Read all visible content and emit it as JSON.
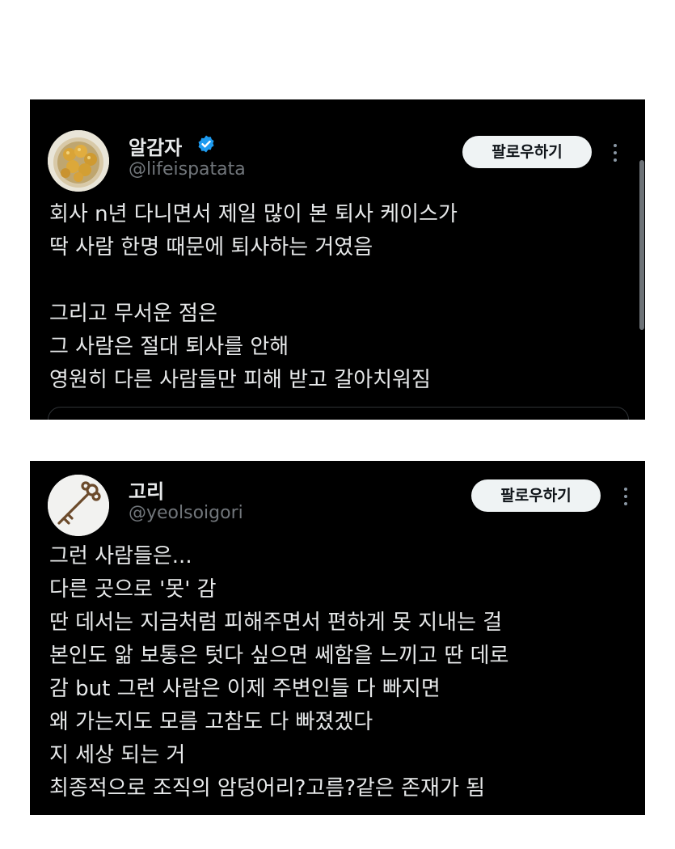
{
  "tweets": [
    {
      "name": "알감자",
      "handle": "@lifeispatata",
      "verified": true,
      "follow_label": "팔로우하기",
      "lines": [
        "회사 n년 다니면서 제일 많이 본 퇴사 케이스가",
        "딱 사람 한명 때문에 퇴사하는 거였음",
        "",
        "그리고 무서운 점은",
        "그 사람은 절대 퇴사를 안해",
        "영원히 다른 사람들만 피해 받고 갈아치워짐"
      ]
    },
    {
      "name": "고리",
      "handle": "@yeolsoigori",
      "verified": false,
      "follow_label": "팔로우하기",
      "lines": [
        "그런 사람들은...",
        "다른 곳으로 '못' 감",
        "딴 데서는 지금처럼 피해주면서 편하게 못 지내는 걸",
        "본인도 앎 보통은 텃다 싶으면 쎄함을 느끼고 딴 데로",
        "감 but 그런 사람은 이제 주변인들 다 빠지면",
        "왜 가는지도 모름 고참도 다 빠졌겠다",
        "지 세상 되는 거",
        "최종적으로 조직의 암덩어리?고름?같은 존재가 됨"
      ]
    }
  ],
  "colors": {
    "card_bg": "#000000",
    "text": "#e7e9ea",
    "handle": "#71767b",
    "verified": "#1d9bf0",
    "button_bg": "#eff3f4"
  },
  "icons": [
    "verified-badge-icon",
    "more-options-icon"
  ]
}
